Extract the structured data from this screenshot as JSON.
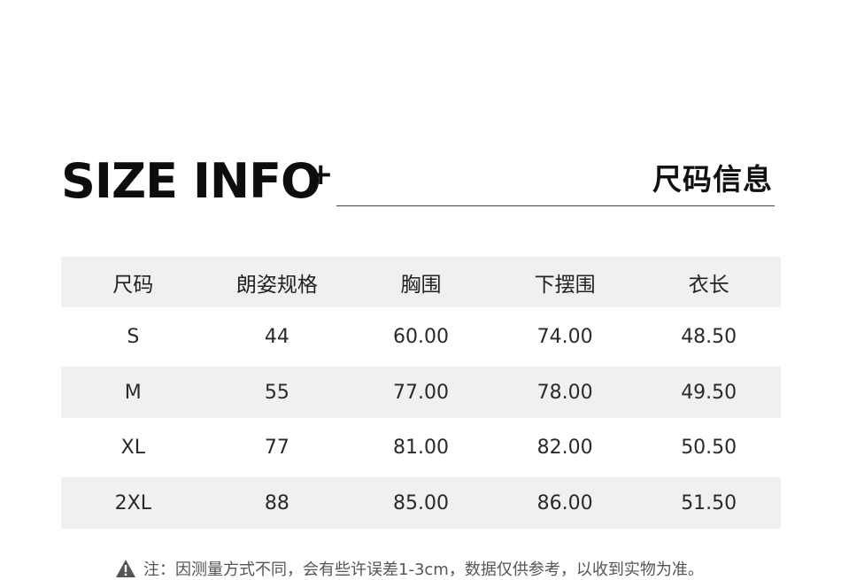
{
  "header": {
    "title_en": "SIZE INFO",
    "plus": "+",
    "title_cn": "尺码信息"
  },
  "table": {
    "columns": [
      "尺码",
      "朗姿规格",
      "胸围",
      "下摆围",
      "衣长"
    ],
    "rows": [
      [
        "S",
        "44",
        "60.00",
        "74.00",
        "48.50"
      ],
      [
        "M",
        "55",
        "77.00",
        "78.00",
        "49.50"
      ],
      [
        "XL",
        "77",
        "81.00",
        "82.00",
        "50.50"
      ],
      [
        "2XL",
        "88",
        "85.00",
        "86.00",
        "51.50"
      ]
    ]
  },
  "note": {
    "icon": "warning-icon",
    "text": "注：因测量方式不同，会有些许误差1-3cm，数据仅供参考，以收到实物为准。"
  },
  "colors": {
    "stripe": "#f0f0f0",
    "text": "#1a1a1a"
  }
}
